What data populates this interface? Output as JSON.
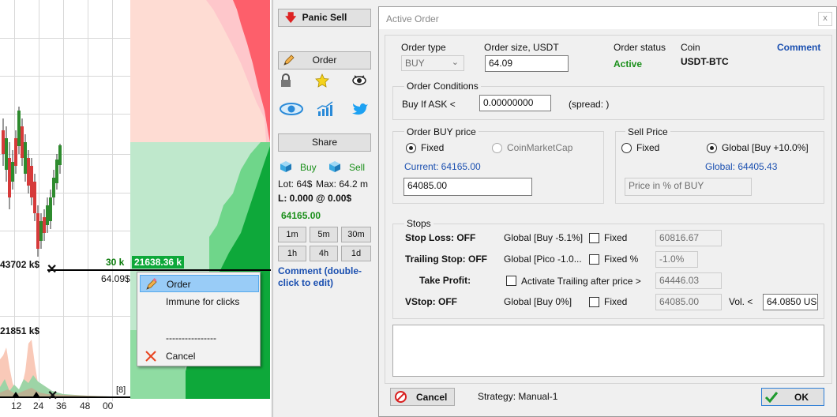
{
  "chart": {
    "price_labels": {
      "high": "43702 k$",
      "mid": "21851 k$",
      "order_line_qty": "30 k",
      "depth_total": "21638.36 k",
      "order_price": "64.09$"
    },
    "x_ticks": [
      "12",
      "24",
      "36",
      "48",
      "00"
    ],
    "bracket_label": "[8]"
  },
  "context_menu": {
    "items": [
      {
        "label": "Order",
        "icon": "pencil-icon",
        "selected": true
      },
      {
        "label": "Immune for clicks"
      },
      {
        "label": "----------------"
      },
      {
        "label": "Cancel",
        "icon": "cancel-x-icon"
      }
    ]
  },
  "side_panel": {
    "panic_sell": "Panic Sell",
    "order": "Order",
    "share": "Share",
    "buy": "Buy",
    "sell": "Sell",
    "lot": "Lot: 64$",
    "max": "Max: 64.2 m",
    "position": "L: 0.000 @ 0.00$",
    "price": "64165.00",
    "timeframes": [
      "1m",
      "5m",
      "30m",
      "1h",
      "4h",
      "1d"
    ],
    "comment": "Comment (double-click to edit)"
  },
  "dialog": {
    "title": "Active Order",
    "close": "x",
    "header": {
      "order_type_label": "Order type",
      "order_type_value": "BUY",
      "order_size_label": "Order size, USDT",
      "order_size_value": "64.09",
      "status_label": "Order status",
      "status_value": "Active",
      "coin_label": "Coin",
      "coin_value": "USDT-BTC",
      "comment_link": "Comment"
    },
    "conditions": {
      "title": "Order Conditions",
      "buy_if_ask": "Buy If ASK <",
      "ask_value": "0.00000000",
      "spread": "(spread: )"
    },
    "buy_price": {
      "title": "Order BUY price",
      "fixed": "Fixed",
      "cmc": "CoinMarketCap",
      "current": "Current: 64165.00",
      "value": "64085.00"
    },
    "sell_price": {
      "title": "Sell Price",
      "fixed": "Fixed",
      "global": "Global [Buy +10.0%]",
      "global_value": "Global: 64405.43",
      "placeholder": "Price in % of BUY"
    },
    "stops": {
      "title": "Stops",
      "stop_loss": "Stop Loss: OFF",
      "stop_loss_global": "Global [Buy -5.1%]",
      "stop_loss_fixed": "Fixed",
      "stop_loss_value": "60816.67",
      "trailing": "Trailing Stop: OFF",
      "trailing_global": "Global [Pico -1.0...",
      "trailing_fixed": "Fixed %",
      "trailing_value": "-1.0%",
      "take_profit": "Take Profit:",
      "activate_trailing": "Activate Trailing after price >",
      "take_profit_value": "64446.03",
      "vstop": "VStop: OFF",
      "vstop_global": "Global [Buy 0%]",
      "vstop_fixed": "Fixed",
      "vstop_value": "64085.00",
      "vol_label": "Vol. <",
      "vol_value": "64.0850 US"
    },
    "footer": {
      "cancel": "Cancel",
      "strategy": "Strategy: Manual-1",
      "ok": "OK"
    }
  },
  "colors": {
    "ask_red": "#fd5f6b",
    "ask_pink": "#fec7cb",
    "ask_light": "#fedcd3",
    "bid_green": "#0ea83a",
    "bid_mid": "#6fd68a",
    "bid_light": "#bfe8cc",
    "active_green": "#1a8f1a",
    "link_blue": "#1a4fb0",
    "menu_highlight": "#99ccf7"
  }
}
